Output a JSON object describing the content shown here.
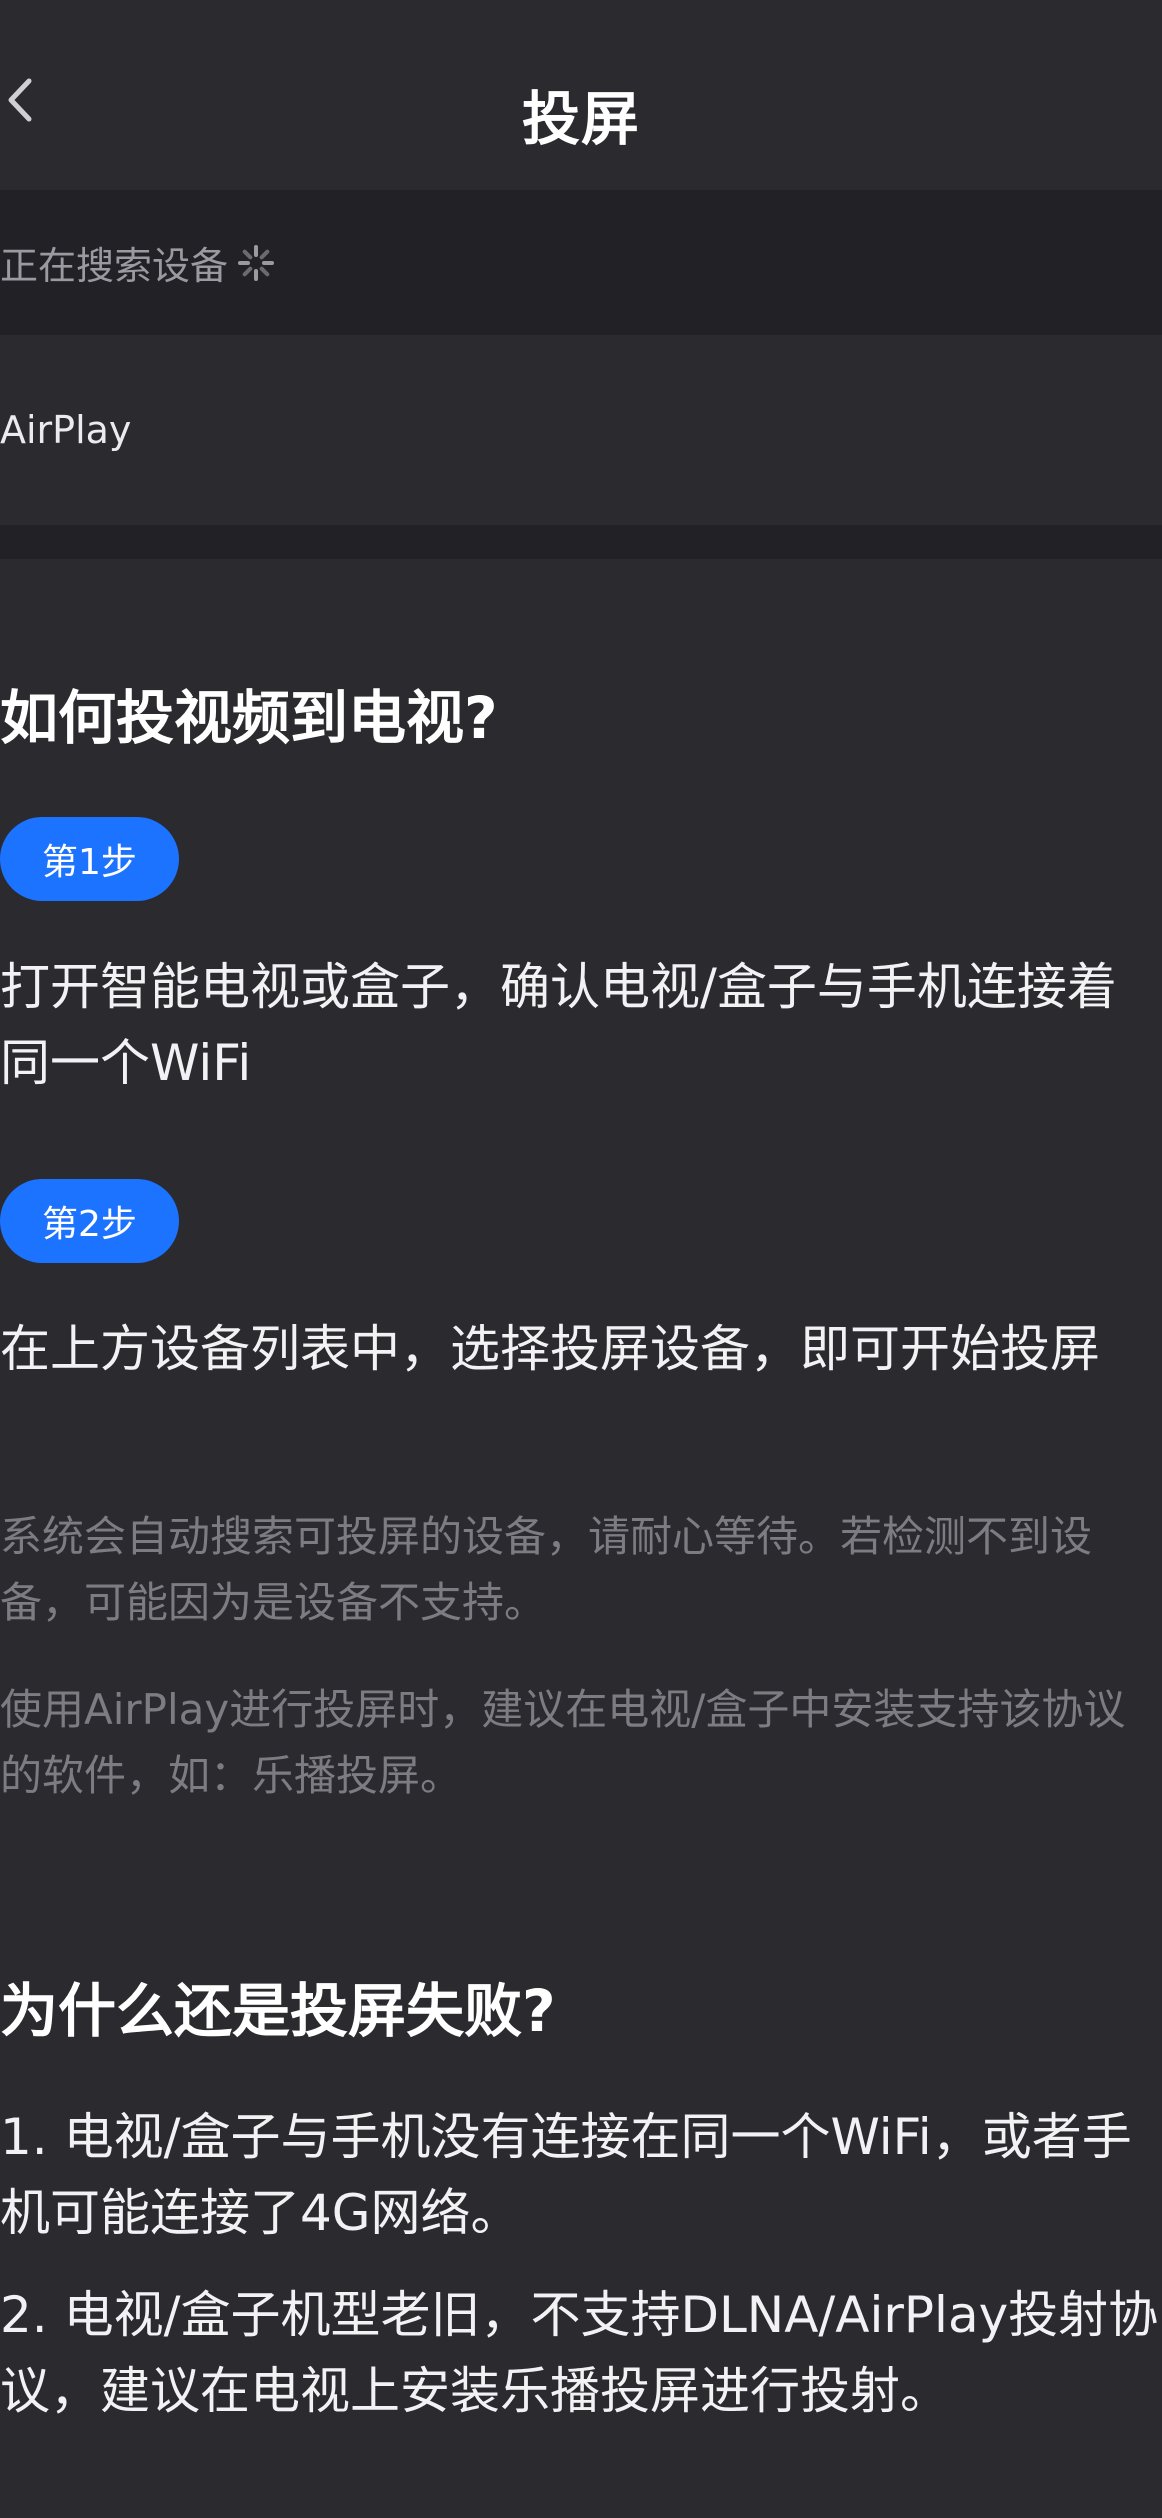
{
  "header": {
    "title": "投屏",
    "back_icon": "chevron-left-icon"
  },
  "search": {
    "status_text": "正在搜索设备",
    "spinner_icon": "loading-spinner-icon"
  },
  "devices": [
    {
      "label": "AirPlay"
    }
  ],
  "guide": {
    "how_title": "如何投视频到电视?",
    "step1_label": "第1步",
    "step1_text": "打开智能电视或盒子，确认电视/盒子与手机连接着同一个WiFi",
    "step2_label": "第2步",
    "step2_text": "在上方设备列表中，选择投屏设备，即可开始投屏",
    "note1": "系统会自动搜索可投屏的设备，请耐心等待。若检测不到设备，可能因为是设备不支持。",
    "note2": "使用AirPlay进行投屏时，建议在电视/盒子中安装支持该协议的软件，如：乐播投屏。",
    "why_title": "为什么还是投屏失败?",
    "why1": "1. 电视/盒子与手机没有连接在同一个WiFi，或者手机可能连接了4G网络。",
    "why2": "2. 电视/盒子机型老旧，不支持DLNA/AirPlay投射协议，建议在电视上安装乐播投屏进行投射。"
  },
  "colors": {
    "background": "#2a2a2f",
    "panel": "#222226",
    "accent": "#1c73ff",
    "muted_text": "#7c7c82"
  }
}
